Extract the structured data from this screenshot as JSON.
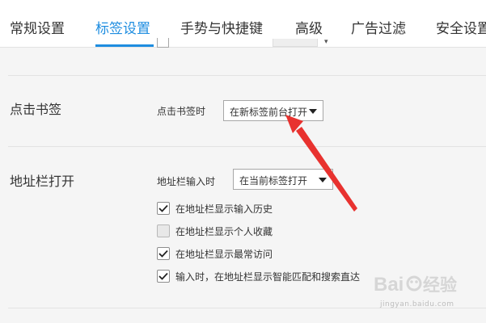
{
  "tabs": [
    {
      "label": "常规设置",
      "active": false
    },
    {
      "label": "标签设置",
      "active": true
    },
    {
      "label": "手势与快捷键",
      "active": false
    },
    {
      "label": "高级",
      "active": false
    },
    {
      "label": "广告过滤",
      "active": false
    },
    {
      "label": "安全设置",
      "active": false
    }
  ],
  "sections": {
    "click_bookmark": {
      "title": "点击书签",
      "field_label": "点击书签时",
      "select_value": "在新标签前台打开"
    },
    "address_bar": {
      "title": "地址栏打开",
      "field_label": "地址栏输入时",
      "select_value": "在当前标签打开",
      "checkboxes": [
        {
          "label": "在地址栏显示输入历史",
          "checked": true
        },
        {
          "label": "在地址栏显示个人收藏",
          "checked": false
        },
        {
          "label": "在地址栏显示最常访问",
          "checked": true
        },
        {
          "label": "输入时，在地址栏显示智能匹配和搜索直达",
          "checked": true
        }
      ]
    }
  },
  "annotation": {
    "color": "#e8322f"
  },
  "watermark": {
    "logo_text": "Baidu经验",
    "url": "jingyan.baidu.com"
  },
  "colors": {
    "accent": "#1e8de0",
    "background": "#f5f5f5"
  }
}
